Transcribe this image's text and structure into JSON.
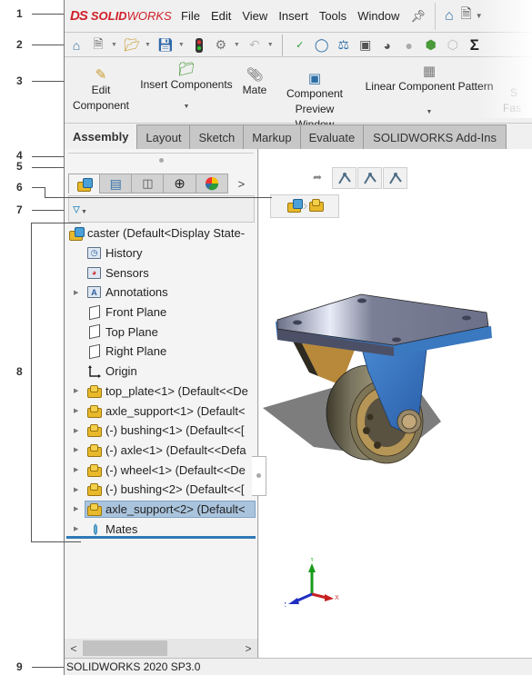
{
  "callouts": [
    "1",
    "2",
    "3",
    "4",
    "5",
    "6",
    "7",
    "8",
    "9"
  ],
  "menubar": {
    "logo_mark": "DS",
    "logo_text_bold": "SOLID",
    "logo_text": "WORKS",
    "items": [
      "File",
      "Edit",
      "View",
      "Insert",
      "Tools",
      "Window"
    ],
    "pin_icon": "pin-icon",
    "right_icons": [
      "home-icon",
      "new-document-icon"
    ]
  },
  "toolbar": {
    "icons": [
      "home-icon",
      "new-document-icon",
      "open-icon",
      "save-icon",
      "traffic-light-icon",
      "options-gear-icon",
      "undo-icon",
      "spellcheck-icon",
      "measure-icon",
      "mass-properties-icon",
      "section-properties-icon",
      "performance-evaluation-icon",
      "assembly-visualization-icon",
      "check-interference-icon",
      "check-clearance-icon",
      "sigma-icon"
    ]
  },
  "ribbon": {
    "buttons": [
      {
        "label": "Edit Component",
        "icon": "edit-component-icon",
        "caret": false
      },
      {
        "label": "Insert Components",
        "icon": "insert-components-icon",
        "caret": true
      },
      {
        "label": "Mate",
        "icon": "mate-paperclip-icon",
        "caret": false
      },
      {
        "label": "Component Preview Window",
        "icon": "component-preview-icon",
        "caret": false
      },
      {
        "label": "Linear Component Pattern",
        "icon": "linear-pattern-icon",
        "caret": true
      },
      {
        "label": "Smart Fasteners",
        "icon": "smart-fasteners-icon",
        "caret": false
      }
    ],
    "partial_labels": [
      "S",
      "Fas"
    ]
  },
  "command_tabs": [
    {
      "label": "Assembly",
      "active": true
    },
    {
      "label": "Layout",
      "active": false
    },
    {
      "label": "Sketch",
      "active": false
    },
    {
      "label": "Markup",
      "active": false
    },
    {
      "label": "Evaluate",
      "active": false
    },
    {
      "label": "SOLIDWORKS Add-Ins",
      "active": false
    }
  ],
  "panel_tabs": [
    {
      "name": "featuremanager-tree",
      "active": true
    },
    {
      "name": "propertymanager",
      "active": false
    },
    {
      "name": "configurationmanager",
      "active": false
    },
    {
      "name": "dimxpertmanager",
      "active": false
    },
    {
      "name": "displaymanager",
      "active": false
    }
  ],
  "panel_more": ">",
  "filter": {
    "icon": "filter-icon"
  },
  "tree": {
    "root": "caster  (Default<Display State-",
    "items": [
      {
        "label": "History",
        "icon": "history-folder",
        "expandable": false
      },
      {
        "label": "Sensors",
        "icon": "sensors-folder",
        "expandable": false
      },
      {
        "label": "Annotations",
        "icon": "annotations-folder",
        "expandable": true
      },
      {
        "label": "Front Plane",
        "icon": "plane",
        "expandable": false
      },
      {
        "label": "Top Plane",
        "icon": "plane",
        "expandable": false
      },
      {
        "label": "Right Plane",
        "icon": "plane",
        "expandable": false
      },
      {
        "label": "Origin",
        "icon": "origin",
        "expandable": false
      },
      {
        "label": "top_plate<1> (Default<<De",
        "icon": "part",
        "expandable": true
      },
      {
        "label": "axle_support<1> (Default<",
        "icon": "part",
        "expandable": true
      },
      {
        "label": "(-) bushing<1> (Default<<[",
        "icon": "part",
        "expandable": true
      },
      {
        "label": "(-) axle<1> (Default<<Defa",
        "icon": "part",
        "expandable": true
      },
      {
        "label": "(-) wheel<1> (Default<<De",
        "icon": "part",
        "expandable": true
      },
      {
        "label": "(-) bushing<2> (Default<<[",
        "icon": "part",
        "expandable": true
      },
      {
        "label": "axle_support<2> (Default<",
        "icon": "part",
        "expandable": true,
        "selected": true
      },
      {
        "label": "Mates",
        "icon": "mates",
        "expandable": true
      }
    ]
  },
  "scrollbar": {
    "left": "<",
    "right": ">",
    "position": 0.0
  },
  "graphics": {
    "hud_buttons": [
      "select-other-icon",
      "select-other-icon",
      "select-other-icon"
    ],
    "breadcrumb": [
      "assembly-caster",
      "part-axle_support"
    ],
    "triad": {
      "x": "X",
      "y": "Y",
      "z": "Z"
    }
  },
  "colors": {
    "brand": "#d0202a",
    "selection": "#aac4dd",
    "tree_end": "#2f79b5",
    "part_blue": "#3a78c0"
  },
  "status": {
    "text": "SOLIDWORKS 2020 SP3.0"
  }
}
